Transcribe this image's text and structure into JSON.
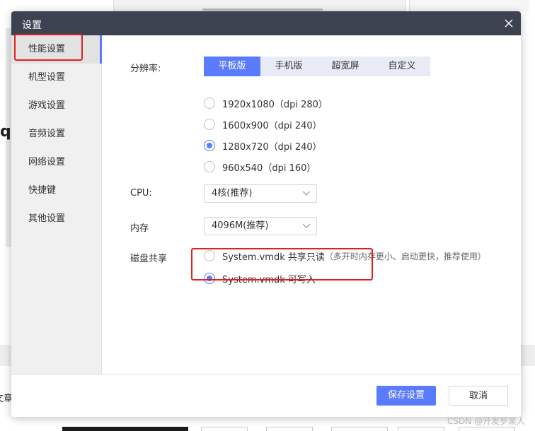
{
  "dialog": {
    "title": "设置",
    "close_icon": "close-icon"
  },
  "sidebar": {
    "items": [
      {
        "label": "性能设置",
        "active": true
      },
      {
        "label": "机型设置",
        "active": false
      },
      {
        "label": "游戏设置",
        "active": false
      },
      {
        "label": "音频设置",
        "active": false
      },
      {
        "label": "网络设置",
        "active": false
      },
      {
        "label": "快捷键",
        "active": false
      },
      {
        "label": "其他设置",
        "active": false
      }
    ]
  },
  "resolution": {
    "label": "分辨率:",
    "tabs": [
      {
        "label": "平板版",
        "active": true
      },
      {
        "label": "手机版",
        "active": false
      },
      {
        "label": "超宽屏",
        "active": false
      },
      {
        "label": "自定义",
        "active": false
      }
    ],
    "options": [
      {
        "label": "1920x1080（dpi 280）",
        "checked": false
      },
      {
        "label": "1600x900（dpi 240）",
        "checked": false
      },
      {
        "label": "1280x720（dpi 240）",
        "checked": true
      },
      {
        "label": "960x540（dpi 160）",
        "checked": false
      }
    ]
  },
  "cpu": {
    "label": "CPU:",
    "value": "4核(推荐)"
  },
  "memory": {
    "label": "内存",
    "value": "4096M(推荐)"
  },
  "disk_share": {
    "label": "磁盘共享",
    "options": [
      {
        "label": "System.vmdk 共享只读",
        "hint": "（多开时内存更小、启动更快，推荐使用）",
        "checked": false
      },
      {
        "label": "System.vmdk 可写入",
        "hint": "",
        "checked": true
      }
    ]
  },
  "footer": {
    "save_label": "保存设置",
    "cancel_label": "取消"
  },
  "background": {
    "left_glyph": "q",
    "left_text": "文章",
    "watermark": "CSDN @开发罗某人"
  },
  "colors": {
    "accent": "#5b7bfe",
    "titlebar": "#3c4250",
    "annotation": "#e02020"
  }
}
